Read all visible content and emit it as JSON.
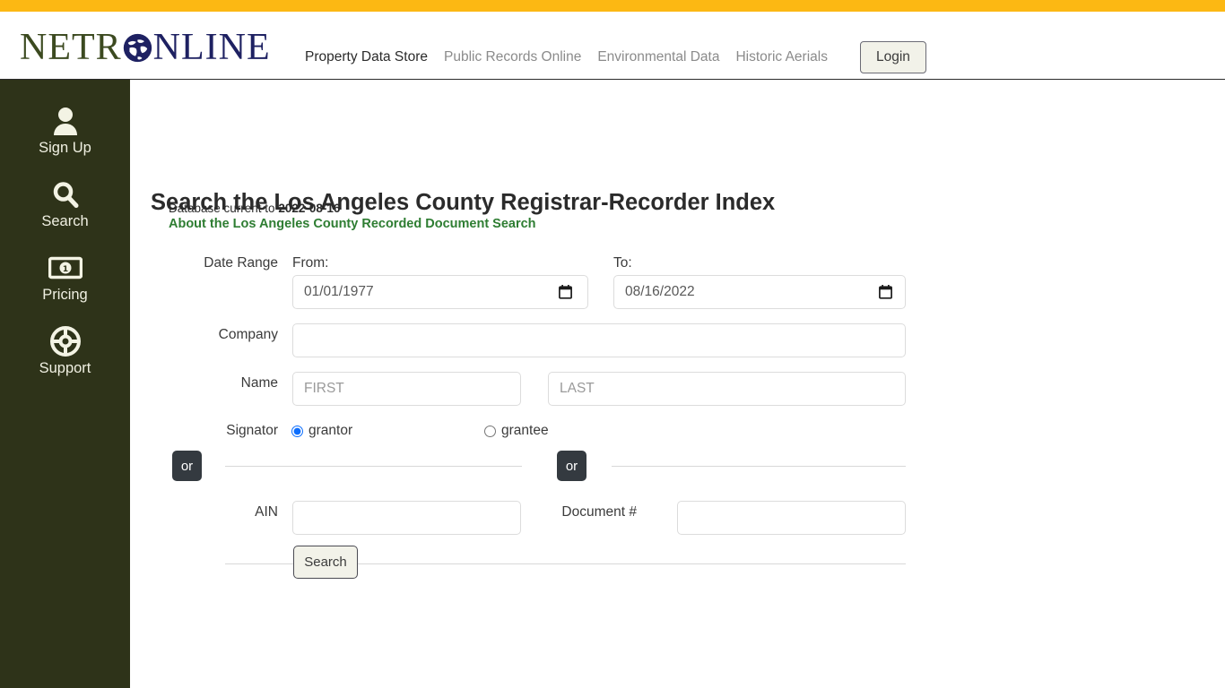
{
  "theme": {
    "gold_bar": "#fcb813",
    "sidebar_bg": "#2e3319",
    "sidebar_text": "#f0f0e2",
    "link_green": "#2e7d32",
    "logo_green": "#3c4a20",
    "logo_navy": "#1e2162",
    "or_badge_bg": "#343a40",
    "button_bg": "#f2f2e9",
    "radio_accent": "#0d6efd"
  },
  "header": {
    "logo": {
      "part1": "NETR",
      "globe_icon": "globe-icon",
      "part2": "NLINE"
    },
    "nav": [
      {
        "label": "Property Data Store",
        "active": true
      },
      {
        "label": "Public Records Online",
        "active": false
      },
      {
        "label": "Environmental Data",
        "active": false
      },
      {
        "label": "Historic Aerials",
        "active": false
      }
    ],
    "login_label": "Login"
  },
  "sidebar": {
    "items": [
      {
        "label": "Sign Up",
        "icon": "user-icon"
      },
      {
        "label": "Search",
        "icon": "magnifier-icon"
      },
      {
        "label": "Pricing",
        "icon": "money-bill-icon"
      },
      {
        "label": "Support",
        "icon": "life-ring-icon"
      }
    ]
  },
  "main": {
    "title": "Search the Los Angeles County Registrar-Recorder Index",
    "db_current_prefix": "Database current to ",
    "db_current_date": "2022-08-16",
    "about_link": "About the Los Angeles County Recorded Document Search",
    "form": {
      "date_range_label": "Date Range",
      "from_label": "From:",
      "to_label": "To:",
      "date_from_value": "01/01/1977",
      "date_to_value": "08/16/2022",
      "company_label": "Company",
      "company_value": "",
      "name_label": "Name",
      "first_placeholder": "FIRST",
      "last_placeholder": "LAST",
      "first_value": "",
      "last_value": "",
      "signator_label": "Signator",
      "signator_options": [
        {
          "label": "grantor",
          "checked": true
        },
        {
          "label": "grantee",
          "checked": false
        }
      ],
      "or_badge_left": "or",
      "or_badge_right": "or",
      "ain_label": "AIN",
      "ain_value": "",
      "document_label": "Document #",
      "document_value": "",
      "search_button": "Search"
    }
  }
}
